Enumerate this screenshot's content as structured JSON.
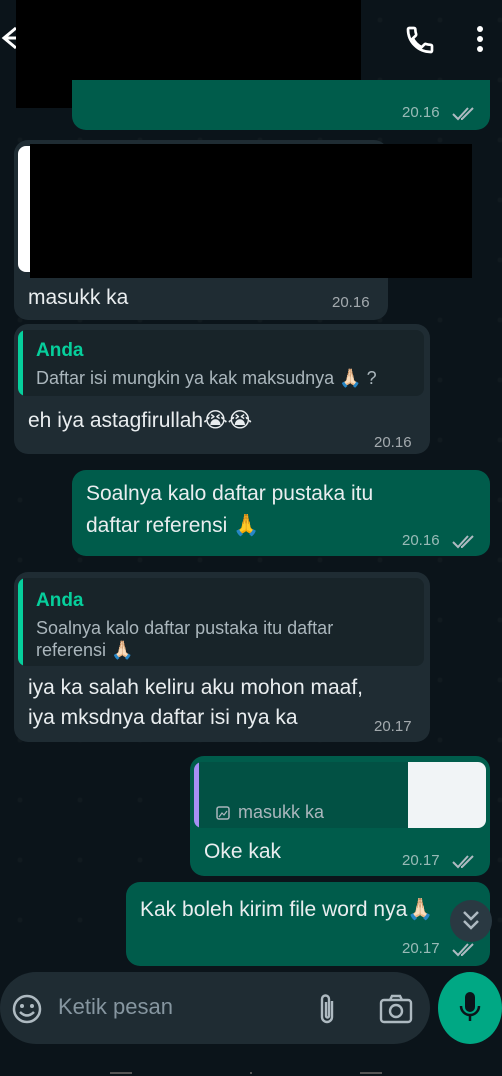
{
  "messages": [
    {
      "direction": "outgoing",
      "time": "20.16",
      "status": "read"
    },
    {
      "direction": "incoming",
      "text": "masukk ka",
      "time": "20.16"
    },
    {
      "direction": "incoming",
      "quote_sender": "Anda",
      "quote_text": "Daftar isi mungkin ya kak maksudnya",
      "quote_emoji": "🙏🏻",
      "quote_suffix": "?",
      "text": "eh iya astagfirullah",
      "emoji": "😭😭",
      "time": "20.16"
    },
    {
      "direction": "outgoing",
      "line1": "Soalnya kalo daftar pustaka itu",
      "line2": "daftar referensi",
      "emoji": "🙏",
      "time": "20.16",
      "status": "read"
    },
    {
      "direction": "incoming",
      "quote_sender": "Anda",
      "quote_line1": "Soalnya kalo daftar pustaka itu daftar",
      "quote_line2": "referensi",
      "quote_emoji": "🙏🏻",
      "line1": "iya ka salah keliru aku mohon maaf,",
      "line2": "iya mksdnya daftar isi nya ka",
      "time": "20.17"
    },
    {
      "direction": "outgoing",
      "quote_text": "masukk ka",
      "text": "Oke kak",
      "time": "20.17",
      "status": "read"
    },
    {
      "direction": "outgoing",
      "text": "Kak boleh kirim file word nya",
      "emoji": "🙏🏻",
      "time": "20.17",
      "status": "read"
    }
  ],
  "composer": {
    "placeholder": "Ketik pesan"
  },
  "colors": {
    "outgoing": "#005c4b",
    "incoming": "#1f2c33",
    "accent": "#00a884",
    "quote_sender": "#06cf9c"
  }
}
